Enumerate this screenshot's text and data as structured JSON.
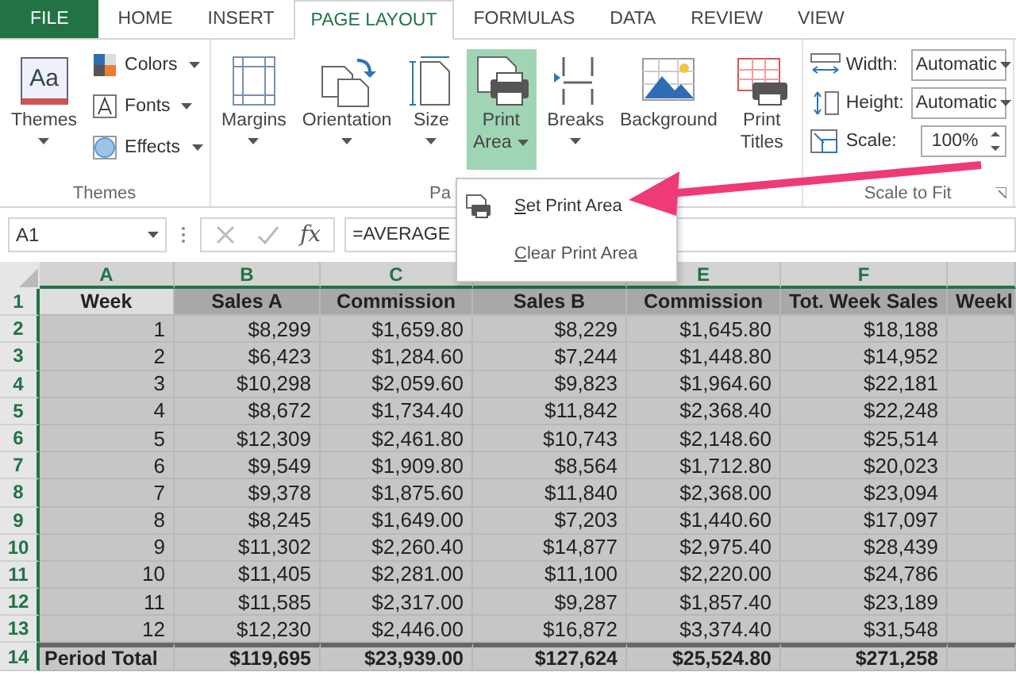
{
  "tabs": [
    {
      "label": "FILE",
      "kind": "file",
      "selected": false
    },
    {
      "label": "HOME",
      "kind": "tab",
      "selected": false
    },
    {
      "label": "INSERT",
      "kind": "tab",
      "selected": false
    },
    {
      "label": "PAGE LAYOUT",
      "kind": "tab",
      "selected": true
    },
    {
      "label": "FORMULAS",
      "kind": "tab",
      "selected": false
    },
    {
      "label": "DATA",
      "kind": "tab",
      "selected": false
    },
    {
      "label": "REVIEW",
      "kind": "tab",
      "selected": false
    },
    {
      "label": "VIEW",
      "kind": "tab",
      "selected": false
    }
  ],
  "ribbon": {
    "groups": [
      {
        "label": "Themes",
        "large": [
          {
            "icon_text": "Aa",
            "lines": [
              "Themes"
            ],
            "dropdown": true,
            "pressed": false
          }
        ],
        "small": [
          {
            "label": "Colors",
            "dropdown": true
          },
          {
            "label": "Fonts",
            "dropdown": true
          },
          {
            "label": "Effects",
            "dropdown": true
          }
        ]
      },
      {
        "label": "Pa",
        "large": [
          {
            "lines": [
              "Margins"
            ],
            "dropdown": true,
            "pressed": false
          },
          {
            "lines": [
              "Orientation"
            ],
            "dropdown": true,
            "pressed": false
          },
          {
            "lines": [
              "Size"
            ],
            "dropdown": true,
            "pressed": false
          },
          {
            "lines": [
              "Print",
              "Area"
            ],
            "dropdown": true,
            "pressed": true
          },
          {
            "lines": [
              "Breaks"
            ],
            "dropdown": true,
            "pressed": false
          },
          {
            "lines": [
              "Background"
            ],
            "dropdown": false,
            "pressed": false
          },
          {
            "lines": [
              "Print",
              "Titles"
            ],
            "dropdown": false,
            "pressed": false
          }
        ]
      },
      {
        "label": "Scale to Fit",
        "fields": [
          {
            "label": "Width:",
            "value": "Automatic",
            "kind": "dropdown"
          },
          {
            "label": "Height:",
            "value": "Automatic",
            "kind": "dropdown"
          },
          {
            "label": "Scale:",
            "value": "100%",
            "kind": "spinner"
          }
        ]
      }
    ]
  },
  "menu": {
    "items": [
      {
        "label": "Set Print Area",
        "highlighted": true
      },
      {
        "label": "Clear Print Area",
        "highlighted": false
      }
    ]
  },
  "formula_bar": {
    "name_box": "A1",
    "function_button": "fx",
    "formula": "=AVERAGE"
  },
  "grid": {
    "columns": [
      {
        "letter": "A"
      },
      {
        "letter": "B"
      },
      {
        "letter": "C"
      },
      {},
      {
        "letter": "E"
      },
      {
        "letter": "F"
      },
      {}
    ],
    "rows": [
      {
        "number": "1",
        "kind": "header",
        "selected": true,
        "cells": [
          "Week",
          "Sales A",
          "Commission",
          "Sales B",
          "Commission",
          "Tot. Week Sales",
          "Weekl"
        ]
      },
      {
        "number": "2",
        "kind": "data",
        "selected": true,
        "cells": [
          "1",
          "$8,299",
          "$1,659.80",
          "$8,229",
          "$1,645.80",
          "$18,188"
        ]
      },
      {
        "number": "3",
        "kind": "data",
        "selected": true,
        "cells": [
          "2",
          "$6,423",
          "$1,284.60",
          "$7,244",
          "$1,448.80",
          "$14,952"
        ]
      },
      {
        "number": "4",
        "kind": "data",
        "selected": true,
        "cells": [
          "3",
          "$10,298",
          "$2,059.60",
          "$9,823",
          "$1,964.60",
          "$22,181"
        ]
      },
      {
        "number": "5",
        "kind": "data",
        "selected": true,
        "cells": [
          "4",
          "$8,672",
          "$1,734.40",
          "$11,842",
          "$2,368.40",
          "$22,248"
        ]
      },
      {
        "number": "6",
        "kind": "data",
        "selected": true,
        "cells": [
          "5",
          "$12,309",
          "$2,461.80",
          "$10,743",
          "$2,148.60",
          "$25,514"
        ]
      },
      {
        "number": "7",
        "kind": "data",
        "selected": true,
        "cells": [
          "6",
          "$9,549",
          "$1,909.80",
          "$8,564",
          "$1,712.80",
          "$20,023"
        ]
      },
      {
        "number": "8",
        "kind": "data",
        "selected": true,
        "cells": [
          "7",
          "$9,378",
          "$1,875.60",
          "$11,840",
          "$2,368.00",
          "$23,094"
        ]
      },
      {
        "number": "9",
        "kind": "data",
        "selected": true,
        "cells": [
          "8",
          "$8,245",
          "$1,649.00",
          "$7,203",
          "$1,440.60",
          "$17,097"
        ]
      },
      {
        "number": "10",
        "kind": "data",
        "selected": true,
        "cells": [
          "9",
          "$11,302",
          "$2,260.40",
          "$14,877",
          "$2,975.40",
          "$28,439"
        ]
      },
      {
        "number": "11",
        "kind": "data",
        "selected": true,
        "cells": [
          "10",
          "$11,405",
          "$2,281.00",
          "$11,100",
          "$2,220.00",
          "$24,786"
        ]
      },
      {
        "number": "12",
        "kind": "data",
        "selected": true,
        "cells": [
          "11",
          "$11,585",
          "$2,317.00",
          "$9,287",
          "$1,857.40",
          "$23,189"
        ]
      },
      {
        "number": "13",
        "kind": "data",
        "selected": true,
        "cells": [
          "12",
          "$12,230",
          "$2,446.00",
          "$16,872",
          "$3,374.40",
          "$31,548"
        ]
      },
      {
        "number": "14",
        "kind": "total",
        "selected": true,
        "cells": [
          "Period Total",
          "$119,695",
          "$23,939.00",
          "$127,624",
          "$25,524.80",
          "$271,258"
        ]
      }
    ]
  }
}
